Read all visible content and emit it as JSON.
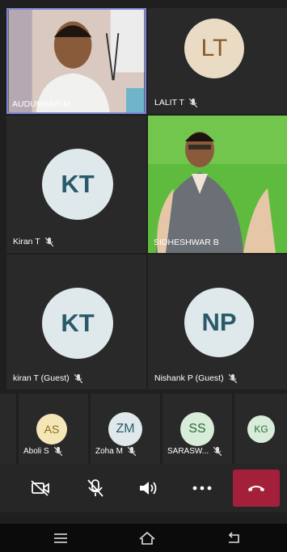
{
  "participants": [
    {
      "name": "AUDUMBAR M",
      "initials": "",
      "video": true,
      "muted": false
    },
    {
      "name": "LALIT T",
      "initials": "LT",
      "video": false,
      "muted": true
    },
    {
      "name": "Kiran T",
      "initials": "KT",
      "video": false,
      "muted": true
    },
    {
      "name": "SIDHESHWAR B",
      "initials": "",
      "video": true,
      "muted": false
    },
    {
      "name": "kiran T (Guest)",
      "initials": "KT",
      "video": false,
      "muted": true
    },
    {
      "name": "Nishank P (Guest)",
      "initials": "NP",
      "video": false,
      "muted": true
    }
  ],
  "strip": [
    {
      "name": "Aboli S",
      "initials": "AS"
    },
    {
      "name": "Zoha M",
      "initials": "ZM"
    },
    {
      "name": "SARASW...",
      "initials": "SS"
    },
    {
      "name": "",
      "initials": "KG"
    }
  ],
  "controls": {
    "camera": "camera-off-icon",
    "mic": "mic-off-icon",
    "speaker": "speaker-icon",
    "more": "more-icon",
    "hangup": "hang-up-icon"
  },
  "colors": {
    "hangup": "#a41f3a",
    "avatar_bg": "#dfe9ec",
    "avatar_text": "#2a5a6a",
    "lt_bg": "#eadcc4",
    "lt_text": "#8a5a2a"
  }
}
